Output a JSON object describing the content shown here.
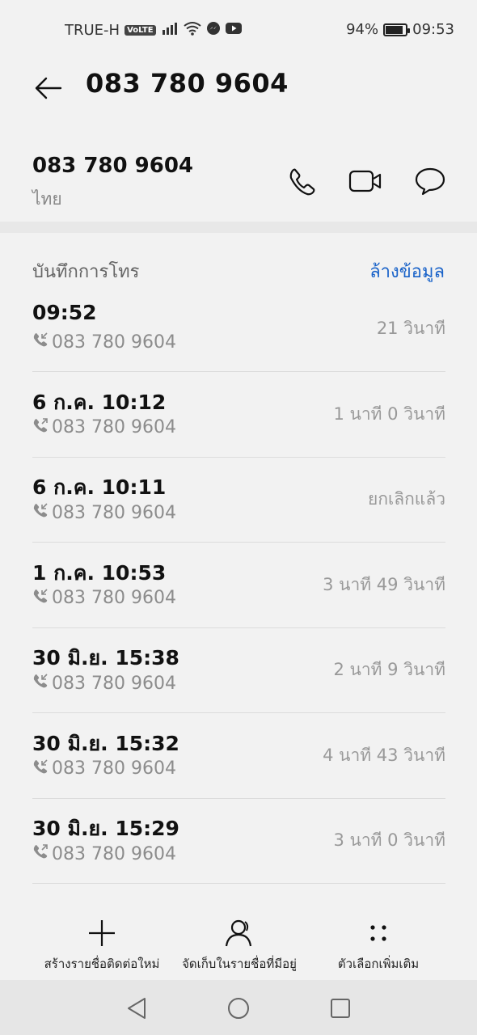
{
  "status_bar": {
    "carrier": "TRUE-H",
    "volte": "VoLTE",
    "battery": "94%",
    "battery_level": 0.94,
    "time": "09:53"
  },
  "header": {
    "title": "083 780 9604"
  },
  "contact": {
    "number": "083 780 9604",
    "region": "ไทย",
    "actions": [
      "phone-icon",
      "video-call-icon",
      "message-icon"
    ]
  },
  "call_log": {
    "title": "บันทึกการโทร",
    "clear_label": "ล้างข้อมูล",
    "entries": [
      {
        "time": "09:52",
        "number": "083 780 9604",
        "duration": "21 วินาที",
        "direction": "incoming"
      },
      {
        "time": "6 ก.ค. 10:12",
        "number": "083 780 9604",
        "duration": "1 นาที 0 วินาที",
        "direction": "outgoing"
      },
      {
        "time": "6 ก.ค. 10:11",
        "number": "083 780 9604",
        "duration": "ยกเลิกแล้ว",
        "direction": "incoming"
      },
      {
        "time": "1 ก.ค. 10:53",
        "number": "083 780 9604",
        "duration": "3 นาที 49 วินาที",
        "direction": "incoming"
      },
      {
        "time": "30 มิ.ย. 15:38",
        "number": "083 780 9604",
        "duration": "2 นาที 9 วินาที",
        "direction": "incoming"
      },
      {
        "time": "30 มิ.ย. 15:32",
        "number": "083 780 9604",
        "duration": "4 นาที 43 วินาที",
        "direction": "incoming"
      },
      {
        "time": "30 มิ.ย. 15:29",
        "number": "083 780 9604",
        "duration": "3 นาที 0 วินาที",
        "direction": "outgoing"
      }
    ]
  },
  "toolbar": {
    "new_contact": "สร้างรายชื่อติดต่อใหม่",
    "save_existing": "จัดเก็บในรายชื่อที่มีอยู่",
    "more_options": "ตัวเลือกเพิ่มเติม"
  },
  "nav": {
    "icons": [
      "back-triangle-icon",
      "home-circle-icon",
      "recents-square-icon"
    ]
  }
}
